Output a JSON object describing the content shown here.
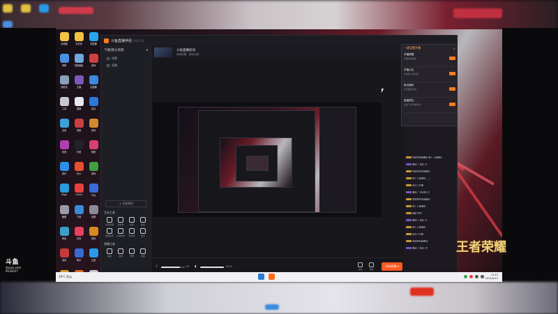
{
  "app": {
    "title": "斗鱼直播伴侣",
    "version": "6.6.3.0",
    "left_header": "下播/默认场景",
    "scene_items": [
      "场景",
      "直播"
    ],
    "add_source": "+ 添加素材",
    "tools_title": "互动工具",
    "tools": [
      "房间管理",
      "贡献榜",
      "投票",
      "抽奖",
      "弹幕助手",
      "礼物特效",
      "粉丝团",
      "更多"
    ],
    "tools2_title": "直播工具",
    "tools2": [
      "美颜",
      "滤镜",
      "录制",
      "截图"
    ],
    "room_title": "斗鱼直播房间",
    "room_sub": "房间标题 · 游戏分类",
    "mic_pct": "80",
    "spk_pct": "100%",
    "bottom_icons": [
      "设置",
      "录制"
    ],
    "go_live": "开始直播 ▾",
    "popup_title": "一键设置开播",
    "popup_items": [
      {
        "name": "开播提醒",
        "sub": "开播自动推送"
      },
      {
        "name": "开播公告",
        "sub": "未设置公告内容"
      },
      {
        "name": "粉丝福利",
        "sub": "暂无福利活动"
      },
      {
        "name": "直播预告",
        "sub": "设置下次开播时间"
      }
    ],
    "chat": [
      "欢迎来到直播间 进入了直播间",
      "赠送了 鱼丸 x1",
      "欢迎来到本直播间",
      "进入了直播间 ......",
      "关注了主播",
      "赠送了 荧光棒 x2",
      "欢迎来到本直播间",
      "进入了直播间",
      "弹幕 666",
      "赠送了 鱼丸 x1",
      "进入了直播间",
      "关注了主播",
      "欢迎来到直播间",
      "赠送了 鱼丸 x5"
    ]
  },
  "desktop": {
    "icons": [
      {
        "label": "此电脑",
        "color": "#f3c242"
      },
      {
        "label": "文件夹",
        "color": "#f3c242"
      },
      {
        "label": "浏览器",
        "color": "#2aa4e8"
      },
      {
        "label": "网络",
        "color": "#4a90e2"
      },
      {
        "label": "控制面板",
        "color": "#6fa8dc"
      },
      {
        "label": "游戏",
        "color": "#d04040"
      },
      {
        "label": "回收站",
        "color": "#8aa0b8"
      },
      {
        "label": "主播",
        "color": "#7a5ab8"
      },
      {
        "label": "加速器",
        "color": "#3a88e0"
      },
      {
        "label": "工具",
        "color": "#c8c8d0"
      },
      {
        "label": "直播",
        "color": "#e8e8ee"
      },
      {
        "label": "会议",
        "color": "#2a78d8"
      },
      {
        "label": "应用",
        "color": "#3aa0d8"
      },
      {
        "label": "剪辑",
        "color": "#c84040"
      },
      {
        "label": "游戏",
        "color": "#d08a30"
      },
      {
        "label": "影音",
        "color": "#b040b0"
      },
      {
        "label": "抖音",
        "color": "#222228"
      },
      {
        "label": "相册",
        "color": "#d84070"
      },
      {
        "label": "音乐",
        "color": "#2a90e8"
      },
      {
        "label": "办公",
        "color": "#e85030"
      },
      {
        "label": "游戏",
        "color": "#40a040"
      },
      {
        "label": "Edge",
        "color": "#2a9ae0"
      },
      {
        "label": "Gmail",
        "color": "#e84040"
      },
      {
        "label": "平台",
        "color": "#3a6ad8"
      },
      {
        "label": "截图",
        "color": "#9a9aa8"
      },
      {
        "label": "下载",
        "color": "#3a8ad8"
      },
      {
        "label": "设置",
        "color": "#8a8a98"
      },
      {
        "label": "商店",
        "color": "#3aa0c8"
      },
      {
        "label": "文档",
        "color": "#e84060"
      },
      {
        "label": "游戏",
        "color": "#d88a20"
      },
      {
        "label": "游戏",
        "color": "#c83a3a"
      },
      {
        "label": "助手",
        "color": "#3a6ad0"
      },
      {
        "label": "云盘",
        "color": "#2a9ae8"
      },
      {
        "label": "网盘",
        "color": "#d0a030"
      },
      {
        "label": "直播",
        "color": "#e86a20"
      },
      {
        "label": "视频",
        "color": "#c8c8d0"
      },
      {
        "label": "商店",
        "color": "#3ab060"
      },
      {
        "label": "游戏",
        "color": "#e84848"
      },
      {
        "label": "工具",
        "color": "#3a80d0"
      }
    ]
  },
  "taskbar": {
    "weather": "28°C 多云",
    "time": "23:43",
    "date": "2024/6/22"
  },
  "watermark": {
    "brand": "斗鱼",
    "site": "douyu.com",
    "room": "9534327"
  },
  "game_logo": "王者荣耀"
}
